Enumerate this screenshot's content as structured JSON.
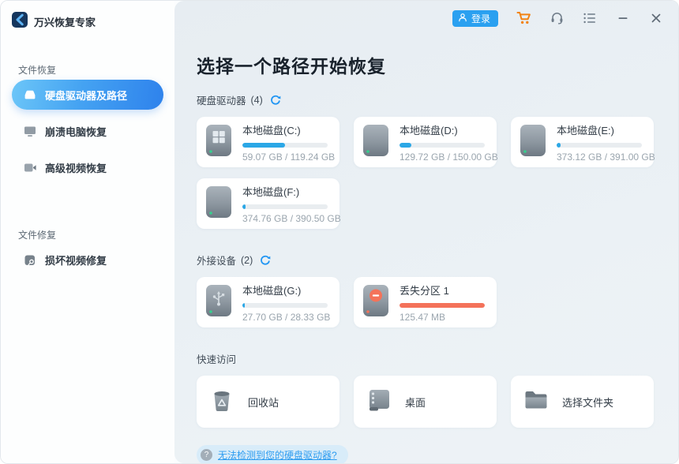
{
  "app": {
    "title": "万兴恢复专家"
  },
  "topbar": {
    "login_label": "登录"
  },
  "sidebar": {
    "section_recovery": {
      "label": "文件恢复"
    },
    "section_repair": {
      "label": "文件修复"
    },
    "items": {
      "drives_paths": "硬盘驱动器及路径",
      "crashed_pc": "崩溃电脑恢复",
      "advanced_video": "高级视频恢复",
      "video_repair": "损坏视频修复"
    }
  },
  "main": {
    "title": "选择一个路径开始恢复",
    "hdd_section": {
      "label": "硬盘驱动器",
      "count": "(4)"
    },
    "external_section": {
      "label": "外接设备",
      "count": "(2)"
    },
    "quick_section": {
      "label": "快速访问"
    },
    "drives": [
      {
        "name": "本地磁盘(C:)",
        "size": "59.07 GB / 119.24 GB",
        "used_percent": 50
      },
      {
        "name": "本地磁盘(D:)",
        "size": "129.72 GB / 150.00 GB",
        "used_percent": 14
      },
      {
        "name": "本地磁盘(E:)",
        "size": "373.12 GB / 391.00 GB",
        "used_percent": 5
      },
      {
        "name": "本地磁盘(F:)",
        "size": "374.76 GB / 390.50 GB",
        "used_percent": 4
      }
    ],
    "external": [
      {
        "name": "本地磁盘(G:)",
        "size": "27.70 GB / 28.33 GB",
        "used_percent": 3,
        "bar_color": "#2ba7e6"
      },
      {
        "name": "丢失分区 1",
        "size": "125.47 MB",
        "used_percent": 100,
        "bar_color": "#f4725a"
      }
    ],
    "quick": [
      {
        "label": "回收站"
      },
      {
        "label": "桌面"
      },
      {
        "label": "选择文件夹"
      }
    ],
    "footer_link": "无法检测到您的硬盘驱动器?"
  },
  "colors": {
    "accent": "#2196f3",
    "bar_fill": "#2ba7e6",
    "bar_lost": "#f4725a",
    "cart_orange": "#f28313",
    "active_gradient_start": "#6cc6f8",
    "active_gradient_end": "#2e82ec"
  }
}
